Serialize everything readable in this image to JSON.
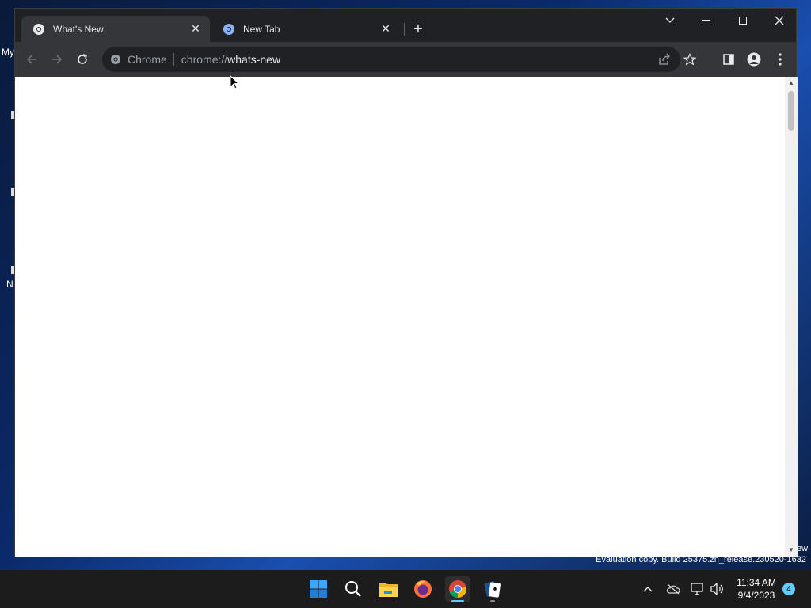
{
  "desktop": {
    "fragment_top": "My",
    "fragment_mid": "N",
    "watermark": "Evaluation copy. Build 25375.zn_release.230520-1632",
    "watermark_fragment": "ew"
  },
  "browser": {
    "tabs": [
      {
        "title": "What's New",
        "active": true,
        "icon": "chrome-icon"
      },
      {
        "title": "New Tab",
        "active": false,
        "icon": "chrome-icon"
      }
    ],
    "omnibox": {
      "chip_label": "Chrome",
      "url_scheme": "chrome://",
      "url_host": "whats-new"
    }
  },
  "taskbar": {
    "apps": [
      "start-icon",
      "search-icon",
      "file-explorer-icon",
      "firefox-icon",
      "chrome-icon",
      "solitaire-icon"
    ],
    "clock": {
      "time": "11:34 AM",
      "date": "9/4/2023"
    },
    "notification_count": "4"
  }
}
